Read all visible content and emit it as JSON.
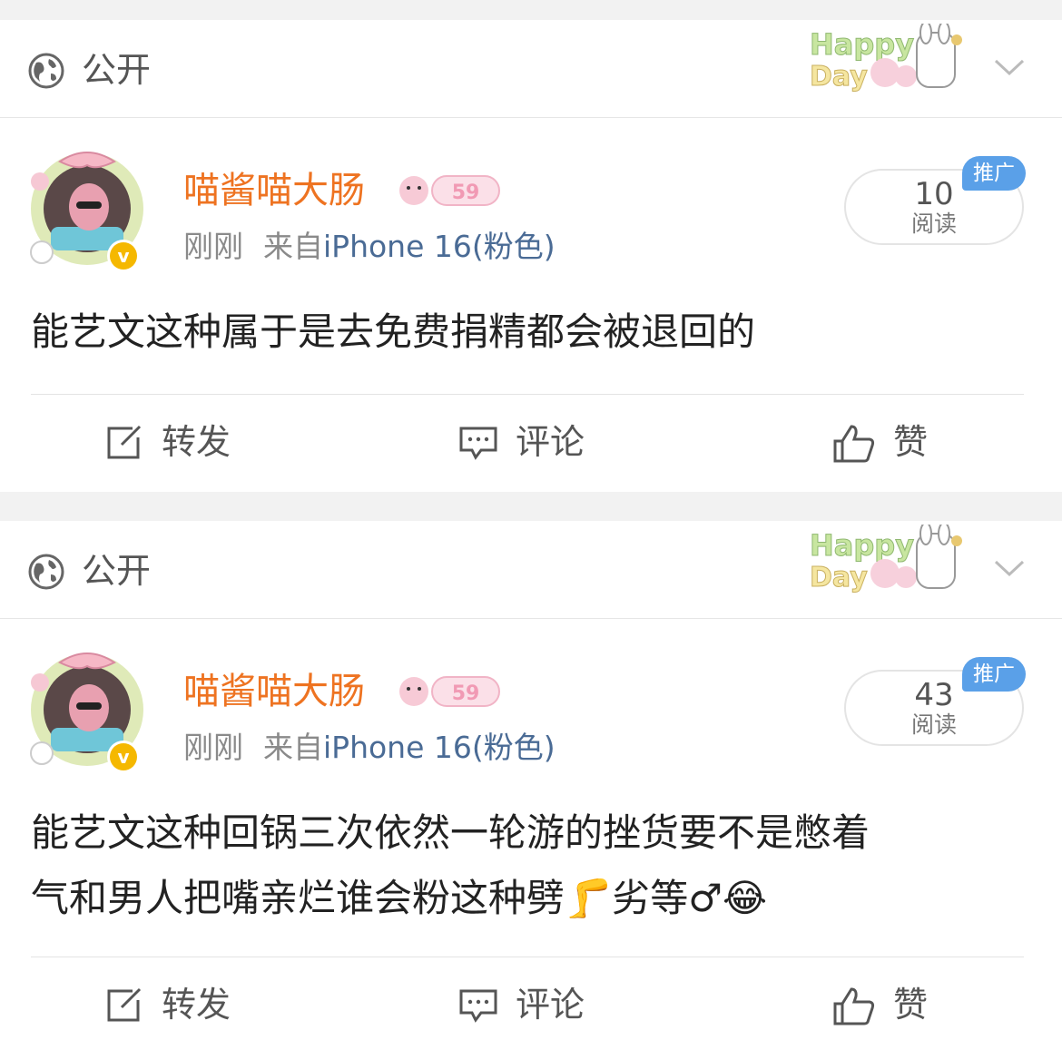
{
  "posts": [
    {
      "privacy_label": "公开",
      "username": "喵酱喵大肠",
      "time": "刚刚",
      "source": "来自",
      "device": "iPhone 16(粉色)",
      "read_count": "10",
      "read_label": "阅读",
      "promo_badge": "推广",
      "text_lines": [
        "能艺文这种属于是去免费捐精都会被退回的"
      ],
      "actions": {
        "repost": "转发",
        "comment": "评论",
        "like": "赞"
      }
    },
    {
      "privacy_label": "公开",
      "username": "喵酱喵大肠",
      "time": "刚刚",
      "source": "来自",
      "device": "iPhone 16(粉色)",
      "read_count": "43",
      "read_label": "阅读",
      "promo_badge": "推广",
      "text_lines": [
        "能艺文这种回锅三次依然一轮游的挫货要不是憋着",
        "气和男人把嘴亲烂谁会粉这种劈🦵劣等♂😂"
      ],
      "actions": {
        "repost": "转发",
        "comment": "评论",
        "like": "赞"
      }
    }
  ],
  "colors": {
    "username": "#ee7321",
    "source": "#4a6b95",
    "promo": "#5aa0e8",
    "verified": "#f5b800"
  },
  "icons": [
    "globe-icon",
    "happy-day-sticker",
    "chevron-down-icon",
    "avatar",
    "verified-icon",
    "vip-badge",
    "repost-icon",
    "comment-icon",
    "like-icon"
  ]
}
